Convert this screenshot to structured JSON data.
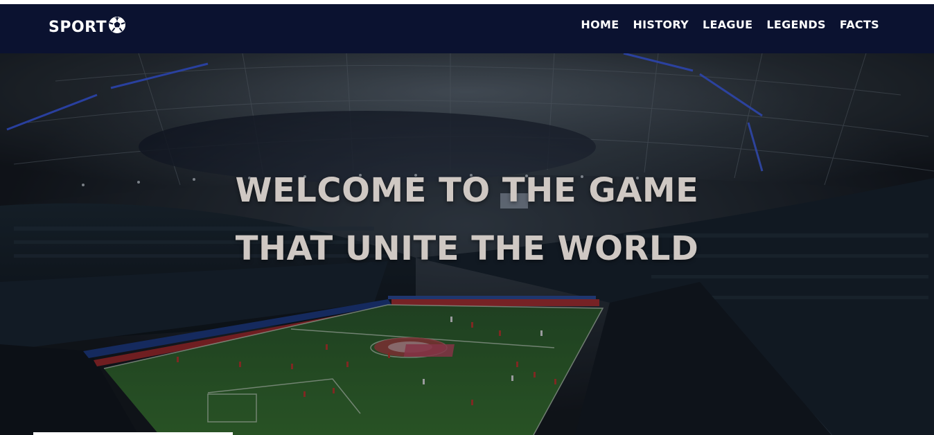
{
  "brand": {
    "name": "SPORT",
    "icon": "soccer-ball-icon"
  },
  "nav": {
    "items": [
      {
        "label": "HOME"
      },
      {
        "label": "HISTORY"
      },
      {
        "label": "LEAGUE"
      },
      {
        "label": "LEGENDS"
      },
      {
        "label": "FACTS"
      }
    ]
  },
  "hero": {
    "line1": "WELCOME TO THE GAME",
    "line2": "THAT UNITE THE WORLD"
  },
  "colors": {
    "navbar": "#0b1230",
    "hero_text": "#cfc8c3",
    "pitch": "#2f6b2a"
  }
}
